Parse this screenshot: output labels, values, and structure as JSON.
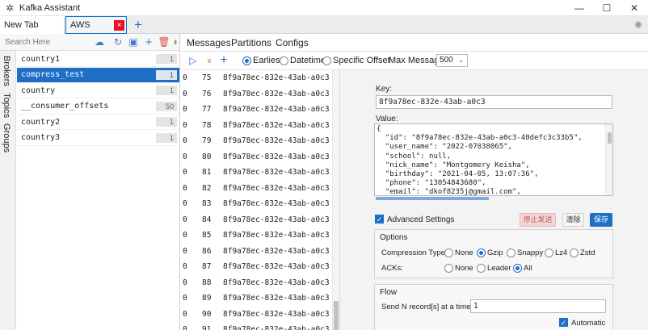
{
  "window": {
    "title": "Kafka Assistant",
    "minimize": "—",
    "maximize": "☐",
    "close": "✕"
  },
  "tabs": [
    {
      "label": "New Tab"
    },
    {
      "label": "AWS",
      "close": "×"
    }
  ],
  "tab_add": "+",
  "side_tabs": [
    "Brokers",
    "Topics",
    "Groups"
  ],
  "topic_toolbar": {
    "search_placeholder": "Search Here"
  },
  "topics": [
    {
      "name": "country1",
      "count": "1"
    },
    {
      "name": "compress_test",
      "count": "1",
      "selected": true
    },
    {
      "name": "country",
      "count": "1"
    },
    {
      "name": "__consumer_offsets",
      "count": "50"
    },
    {
      "name": "country2",
      "count": "1"
    },
    {
      "name": "country3",
      "count": "1"
    }
  ],
  "subtabs": [
    "Messages",
    "Partitions",
    "Configs"
  ],
  "msg_toolbar": {
    "offset_options": [
      "Earliest",
      "Datetime",
      "Specific Offset"
    ],
    "selected_offset": "Earliest",
    "max_messages_label": "Max Messages:",
    "max_messages_value": "500"
  },
  "messages": [
    {
      "partition": "0",
      "offset": "75",
      "key": "8f9a78ec-832e-43ab-a0c3"
    },
    {
      "partition": "0",
      "offset": "76",
      "key": "8f9a78ec-832e-43ab-a0c3"
    },
    {
      "partition": "0",
      "offset": "77",
      "key": "8f9a78ec-832e-43ab-a0c3"
    },
    {
      "partition": "0",
      "offset": "78",
      "key": "8f9a78ec-832e-43ab-a0c3"
    },
    {
      "partition": "0",
      "offset": "79",
      "key": "8f9a78ec-832e-43ab-a0c3"
    },
    {
      "partition": "0",
      "offset": "80",
      "key": "8f9a78ec-832e-43ab-a0c3"
    },
    {
      "partition": "0",
      "offset": "81",
      "key": "8f9a78ec-832e-43ab-a0c3"
    },
    {
      "partition": "0",
      "offset": "82",
      "key": "8f9a78ec-832e-43ab-a0c3"
    },
    {
      "partition": "0",
      "offset": "83",
      "key": "8f9a78ec-832e-43ab-a0c3"
    },
    {
      "partition": "0",
      "offset": "84",
      "key": "8f9a78ec-832e-43ab-a0c3"
    },
    {
      "partition": "0",
      "offset": "85",
      "key": "8f9a78ec-832e-43ab-a0c3"
    },
    {
      "partition": "0",
      "offset": "86",
      "key": "8f9a78ec-832e-43ab-a0c3"
    },
    {
      "partition": "0",
      "offset": "87",
      "key": "8f9a78ec-832e-43ab-a0c3"
    },
    {
      "partition": "0",
      "offset": "88",
      "key": "8f9a78ec-832e-43ab-a0c3"
    },
    {
      "partition": "0",
      "offset": "89",
      "key": "8f9a78ec-832e-43ab-a0c3"
    },
    {
      "partition": "0",
      "offset": "90",
      "key": "8f9a78ec-832e-43ab-a0c3"
    },
    {
      "partition": "0",
      "offset": "91",
      "key": "8f9a78ec-832e-43ab-a0c3"
    }
  ],
  "detail": {
    "key_label": "Key:",
    "key_value": "8f9a78ec-832e-43ab-a0c3",
    "value_label": "Value:",
    "value_lines": [
      "{",
      "  \"id\": \"8f9a78ec-832e-43ab-a0c3-40defc3c33b5\",",
      "  \"user_name\": \"2022-07038065\",",
      "  \"school\": null,",
      "  \"nick_name\": \"Montgomery Keisha\",",
      "  \"birthday\": \"2021-04-05, 13:07:36\",",
      "  \"phone\": \"13054843680\",",
      "  \"email\": \"dkof8235j@gmail.com\","
    ],
    "advanced_settings_label": "Advanced Settings",
    "stop_button": "停止发送",
    "clear_button": "清除",
    "save_button": "保存",
    "options": {
      "title": "Options",
      "compression_label": "Compression Type:",
      "compression_options": [
        "None",
        "Gzip",
        "Snappy",
        "Lz4",
        "Zstd"
      ],
      "compression_selected": "Gzip",
      "acks_label": "ACKs:",
      "acks_options": [
        "None",
        "Leader",
        "All"
      ],
      "acks_selected": "All"
    },
    "flow": {
      "title": "Flow",
      "send_label": "Send N record[s] at a time:",
      "send_value": "1",
      "automatic_label": "Automatic"
    }
  },
  "colors": {
    "accent": "#1e6ec8",
    "selected_row": "#1e6fc5",
    "stop_button_bg": "#f3d6d6",
    "close_tab": "#e81123"
  }
}
